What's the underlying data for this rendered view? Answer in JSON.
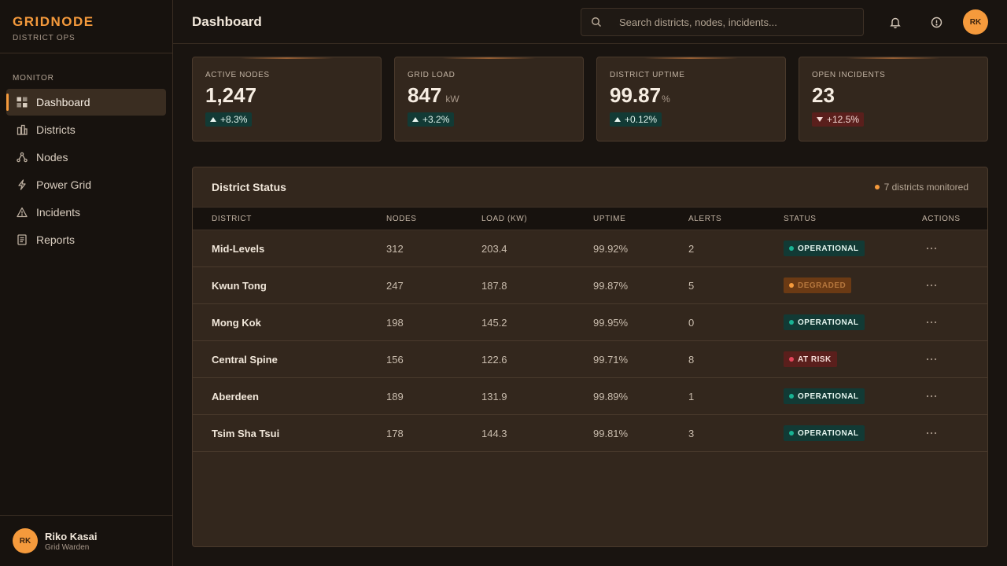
{
  "brand": {
    "name": "GRIDNODE",
    "sub": "DISTRICT OPS"
  },
  "sidebar": {
    "section": "MONITOR",
    "items": [
      {
        "label": "Dashboard",
        "icon": "grid-icon"
      },
      {
        "label": "Districts",
        "icon": "buildings-icon"
      },
      {
        "label": "Nodes",
        "icon": "nodes-icon"
      },
      {
        "label": "Power Grid",
        "icon": "bolt-icon"
      },
      {
        "label": "Incidents",
        "icon": "warning-icon"
      },
      {
        "label": "Reports",
        "icon": "document-icon"
      }
    ],
    "active_index": 0
  },
  "user": {
    "initials": "RK",
    "name": "Riko Kasai",
    "role": "Grid Warden"
  },
  "header": {
    "title": "Dashboard",
    "search_placeholder": "Search districts, nodes, incidents...",
    "avatar_initials": "RK"
  },
  "kpis": [
    {
      "label": "ACTIVE NODES",
      "value": "1,247",
      "unit": "",
      "delta": "+8.3%",
      "trend": "up"
    },
    {
      "label": "GRID LOAD",
      "value": "847",
      "unit": "kW",
      "delta": "+3.2%",
      "trend": "up"
    },
    {
      "label": "DISTRICT UPTIME",
      "value": "99.87",
      "unit": "%",
      "delta": "+0.12%",
      "trend": "up"
    },
    {
      "label": "OPEN INCIDENTS",
      "value": "23",
      "unit": "",
      "delta": "+12.5%",
      "trend": "down"
    }
  ],
  "table": {
    "title": "District Status",
    "meta": "7 districts monitored",
    "columns": [
      "DISTRICT",
      "NODES",
      "LOAD (KW)",
      "UPTIME",
      "ALERTS",
      "STATUS",
      "ACTIONS"
    ],
    "rows": [
      {
        "district": "Mid-Levels",
        "nodes": "312",
        "load": "203.4",
        "uptime": "99.92%",
        "alerts": "2",
        "status": "OPERATIONAL",
        "status_type": "operational"
      },
      {
        "district": "Kwun Tong",
        "nodes": "247",
        "load": "187.8",
        "uptime": "99.87%",
        "alerts": "5",
        "status": "DEGRADED",
        "status_type": "degraded"
      },
      {
        "district": "Mong Kok",
        "nodes": "198",
        "load": "145.2",
        "uptime": "99.95%",
        "alerts": "0",
        "status": "OPERATIONAL",
        "status_type": "operational"
      },
      {
        "district": "Central Spine",
        "nodes": "156",
        "load": "122.6",
        "uptime": "99.71%",
        "alerts": "8",
        "status": "AT RISK",
        "status_type": "atrisk"
      },
      {
        "district": "Aberdeen",
        "nodes": "189",
        "load": "131.9",
        "uptime": "99.89%",
        "alerts": "1",
        "status": "OPERATIONAL",
        "status_type": "operational"
      },
      {
        "district": "Tsim Sha Tsui",
        "nodes": "178",
        "load": "144.3",
        "uptime": "99.81%",
        "alerts": "3",
        "status": "OPERATIONAL",
        "status_type": "operational"
      }
    ]
  },
  "colors": {
    "accent": "#f59a3c",
    "operational": "#19b394",
    "degraded": "#f59a3c",
    "atrisk": "#e2445a"
  }
}
